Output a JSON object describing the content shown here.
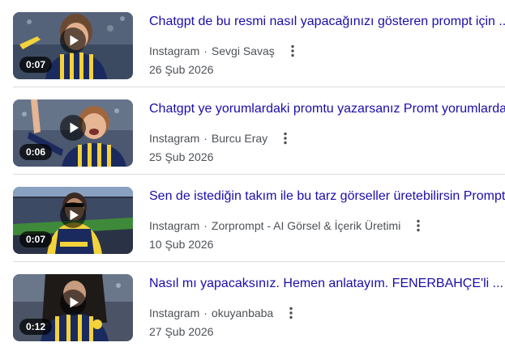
{
  "results": [
    {
      "title": "Chatgpt de bu resmi nasıl yapacağınızı gösteren prompt için ...",
      "source": "Instagram",
      "separator": "·",
      "author": "Sevgi Savaş",
      "date": "26 Şub 2026",
      "duration": "0:07"
    },
    {
      "title": "Chatgpt ye yorumlardaki promtu yazarsanız Promt yorumlarda",
      "source": "Instagram",
      "separator": "·",
      "author": "Burcu Eray",
      "date": "25 Şub 2026",
      "duration": "0:06"
    },
    {
      "title": "Sen de istediğin takım ile bu tarz görseller üretebilirsin Prompt",
      "source": "Instagram",
      "separator": "·",
      "author": "Zorprompt - AI Görsel & İçerik Üretimi",
      "date": "10 Şub 2026",
      "duration": "0:07"
    },
    {
      "title": "Nasıl mı yapacaksınız. Hemen anlatayım. FENERBAHÇE'li ...",
      "source": "Instagram",
      "separator": "·",
      "author": "okuyanbaba",
      "date": "27 Şub 2026",
      "duration": "0:12"
    }
  ],
  "icons": {
    "play": "play-icon",
    "more": "more-vert-icon"
  },
  "colors": {
    "link": "#1a0dab",
    "meta_text": "#4d5156",
    "divider": "#dadce0",
    "jersey_navy": "#1b2a5e",
    "jersey_yellow": "#f3d23a"
  }
}
